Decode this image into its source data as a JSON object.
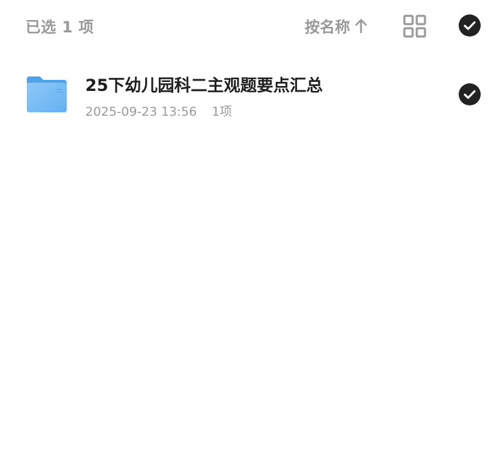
{
  "header": {
    "selected_count": "已选 1 项",
    "sort_label": "按名称",
    "sort_direction_icon": "arrow-up-icon",
    "view_toggle_icon": "grid-view-icon",
    "select_all_icon": "check-circle-icon"
  },
  "files": [
    {
      "name": "25下幼儿园科二主观题要点汇总",
      "modified": "2025-09-23 13:56",
      "item_count": "1项",
      "icon": "folder-icon",
      "selected": true
    }
  ],
  "colors": {
    "muted_text": "#999999",
    "primary_text": "#1e1e1e",
    "check_fill": "#222222",
    "folder_blue": "#5aaaf0"
  }
}
